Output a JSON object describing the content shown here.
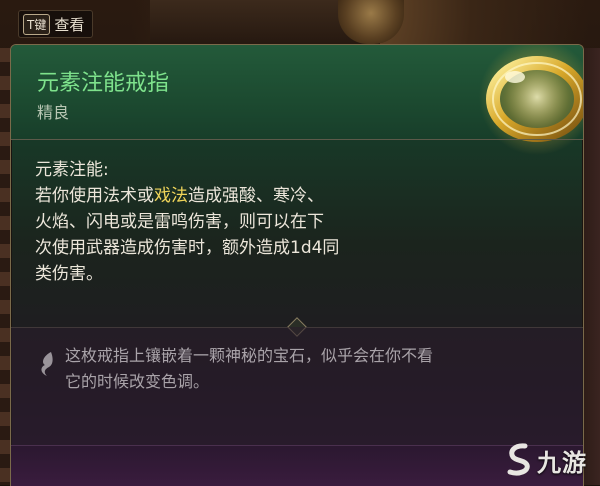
{
  "hint": {
    "key_label": "T键",
    "action_label": "查看"
  },
  "item": {
    "name": "元素注能戒指",
    "rarity": "精良",
    "icon": "gold-ring-icon",
    "name_color": "#7ee28c",
    "highlight_color": "#f0d55a"
  },
  "description": {
    "heading": "元素注能:",
    "line1_a": "若你使用法术或",
    "line1_hl": "戏法",
    "line1_b": "造成强酸、寒冷、",
    "line2": "火焰、闪电或是雷鸣伤害，则可以在下",
    "line3": "次使用武器造成伤害时，额外造成1d4同",
    "line4": "类伤害。"
  },
  "flavor": {
    "icon": "quill-icon",
    "line1": "这枚戒指上镶嵌着一颗神秘的宝石，似乎会在你不看",
    "line2": "它的时候改变色调。"
  },
  "watermark": {
    "text": "九游"
  }
}
